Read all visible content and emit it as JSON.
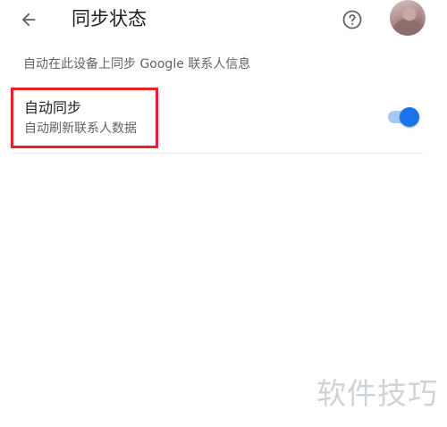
{
  "app_bar": {
    "back_icon": "arrow-back-icon",
    "title": "同步状态",
    "help_icon": "help-circle-icon",
    "avatar_icon": "account-avatar"
  },
  "subtitle": "自动在此设备上同步 Google 联系人信息",
  "setting": {
    "title": "自动同步",
    "description": "自动刷新联系人数据",
    "toggle_on": true,
    "highlight_color": "#e8212b"
  },
  "colors": {
    "accent": "#1a73e8",
    "accent_track": "#a6c8f7",
    "text_primary": "#202124",
    "text_secondary": "#5f6368"
  },
  "watermark": "软件技巧"
}
